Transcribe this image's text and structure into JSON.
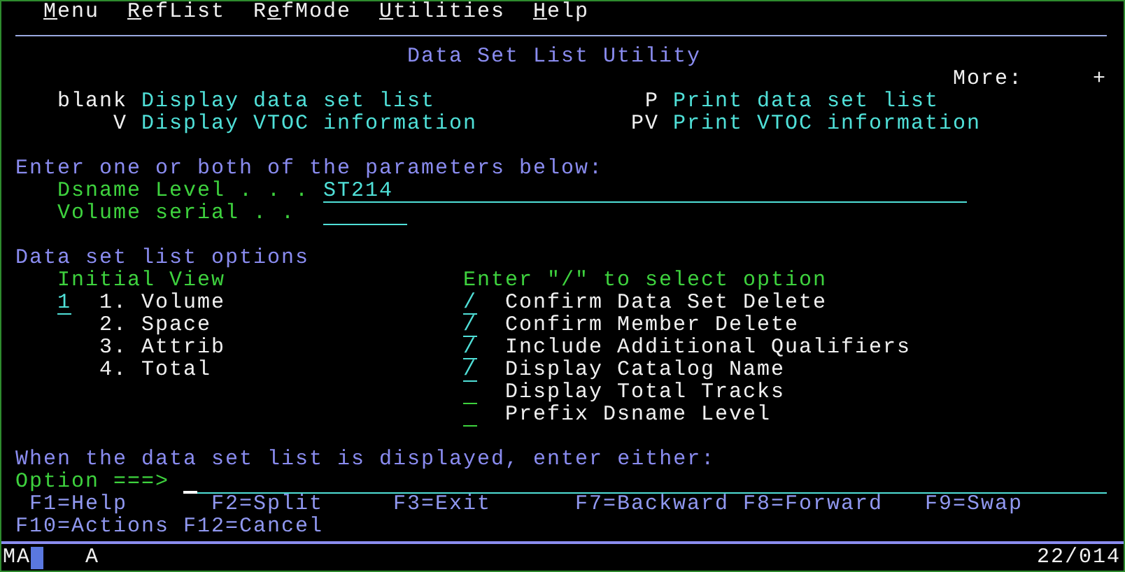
{
  "menu_bar": [
    {
      "key": "M",
      "rest": "enu"
    },
    {
      "key": "R",
      "rest": "efList"
    },
    {
      "pre": "R",
      "key": "e",
      "rest": "fMode"
    },
    {
      "key": "U",
      "rest": "tilities"
    },
    {
      "key": "H",
      "rest": "elp"
    }
  ],
  "title": "Data Set List Utility",
  "more": {
    "label": "More:",
    "sign": "+"
  },
  "actions": [
    {
      "code": "blank",
      "label": "Display data set list"
    },
    {
      "code": "P",
      "label": "Print data set list"
    },
    {
      "code": "V",
      "label": "Display VTOC information"
    },
    {
      "code": "PV",
      "label": "Print VTOC information"
    }
  ],
  "parameters": {
    "prompt": "Enter one or both of the parameters below:",
    "fields": [
      {
        "label": "Dsname Level . . .",
        "value": "ST214"
      },
      {
        "label": "Volume serial . ."
      }
    ]
  },
  "list_options": {
    "heading": "Data set list options",
    "initial_view": {
      "label": "Initial View",
      "value": "1",
      "options": [
        "1. Volume",
        "2. Space",
        "3. Attrib",
        "4. Total"
      ]
    },
    "select": {
      "label": "Enter \"/\" to select option",
      "options": [
        {
          "label": "Confirm Data Set Delete",
          "checked": true,
          "value": "/"
        },
        {
          "label": "Confirm Member Delete",
          "checked": true,
          "value": "/"
        },
        {
          "label": "Include Additional Qualifiers",
          "checked": true,
          "value": "/"
        },
        {
          "label": "Display Catalog Name",
          "checked": true,
          "value": "/"
        },
        {
          "label": "Display Total Tracks",
          "checked": false
        },
        {
          "label": "Prefix Dsname Level",
          "checked": false
        }
      ]
    }
  },
  "command": {
    "prompt": "When the data set list is displayed, enter either:",
    "label": "Option ===>"
  },
  "function_keys": [
    "F1=Help",
    "F2=Split",
    "F3=Exit",
    "F7=Backward",
    "F8=Forward",
    "F9=Swap",
    "F10=Actions",
    "F12=Cancel"
  ],
  "status_bar": {
    "session": "MA",
    "mode": "A",
    "position": "22/014"
  }
}
